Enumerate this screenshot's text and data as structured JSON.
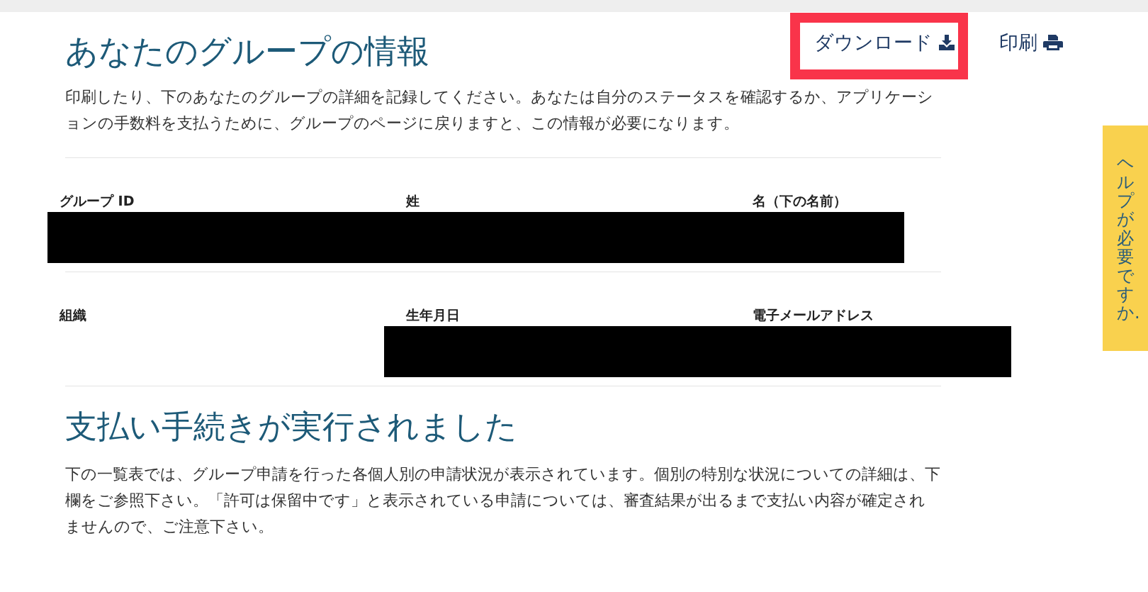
{
  "actions": [
    {
      "kind": "download",
      "label": "ダウンロード",
      "highlighted": true
    },
    {
      "kind": "print",
      "label": "印刷",
      "highlighted": false
    }
  ],
  "group_info": {
    "title": "あなたのグループの情報",
    "description": "印刷したり、下のあなたのグループの詳細を記録してください。あなたは自分のステータスを確認するか、アプリケーションの手数料を支払うために、グループのページに戻りますと、この情報が必要になります。",
    "rows": [
      {
        "labels": [
          "グループ ID",
          "姓",
          "名（下の名前）"
        ],
        "redacted": true
      },
      {
        "labels": [
          "組織",
          "生年月日",
          "電子メールアドレス"
        ],
        "redacted": true
      }
    ]
  },
  "payment": {
    "title": "支払い手続きが実行されました",
    "description": "下の一覧表では、グループ申請を行った各個人別の申請状況が表示されています。個別の特別な状況についての詳細は、下欄をご参照下さい。「許可は保留中です」と表示されている申請については、審査結果が出るまで支払い内容が確定されませんので、ご注意下さい。"
  },
  "help_tab": {
    "label": "ヘルプが必要ですか."
  }
}
